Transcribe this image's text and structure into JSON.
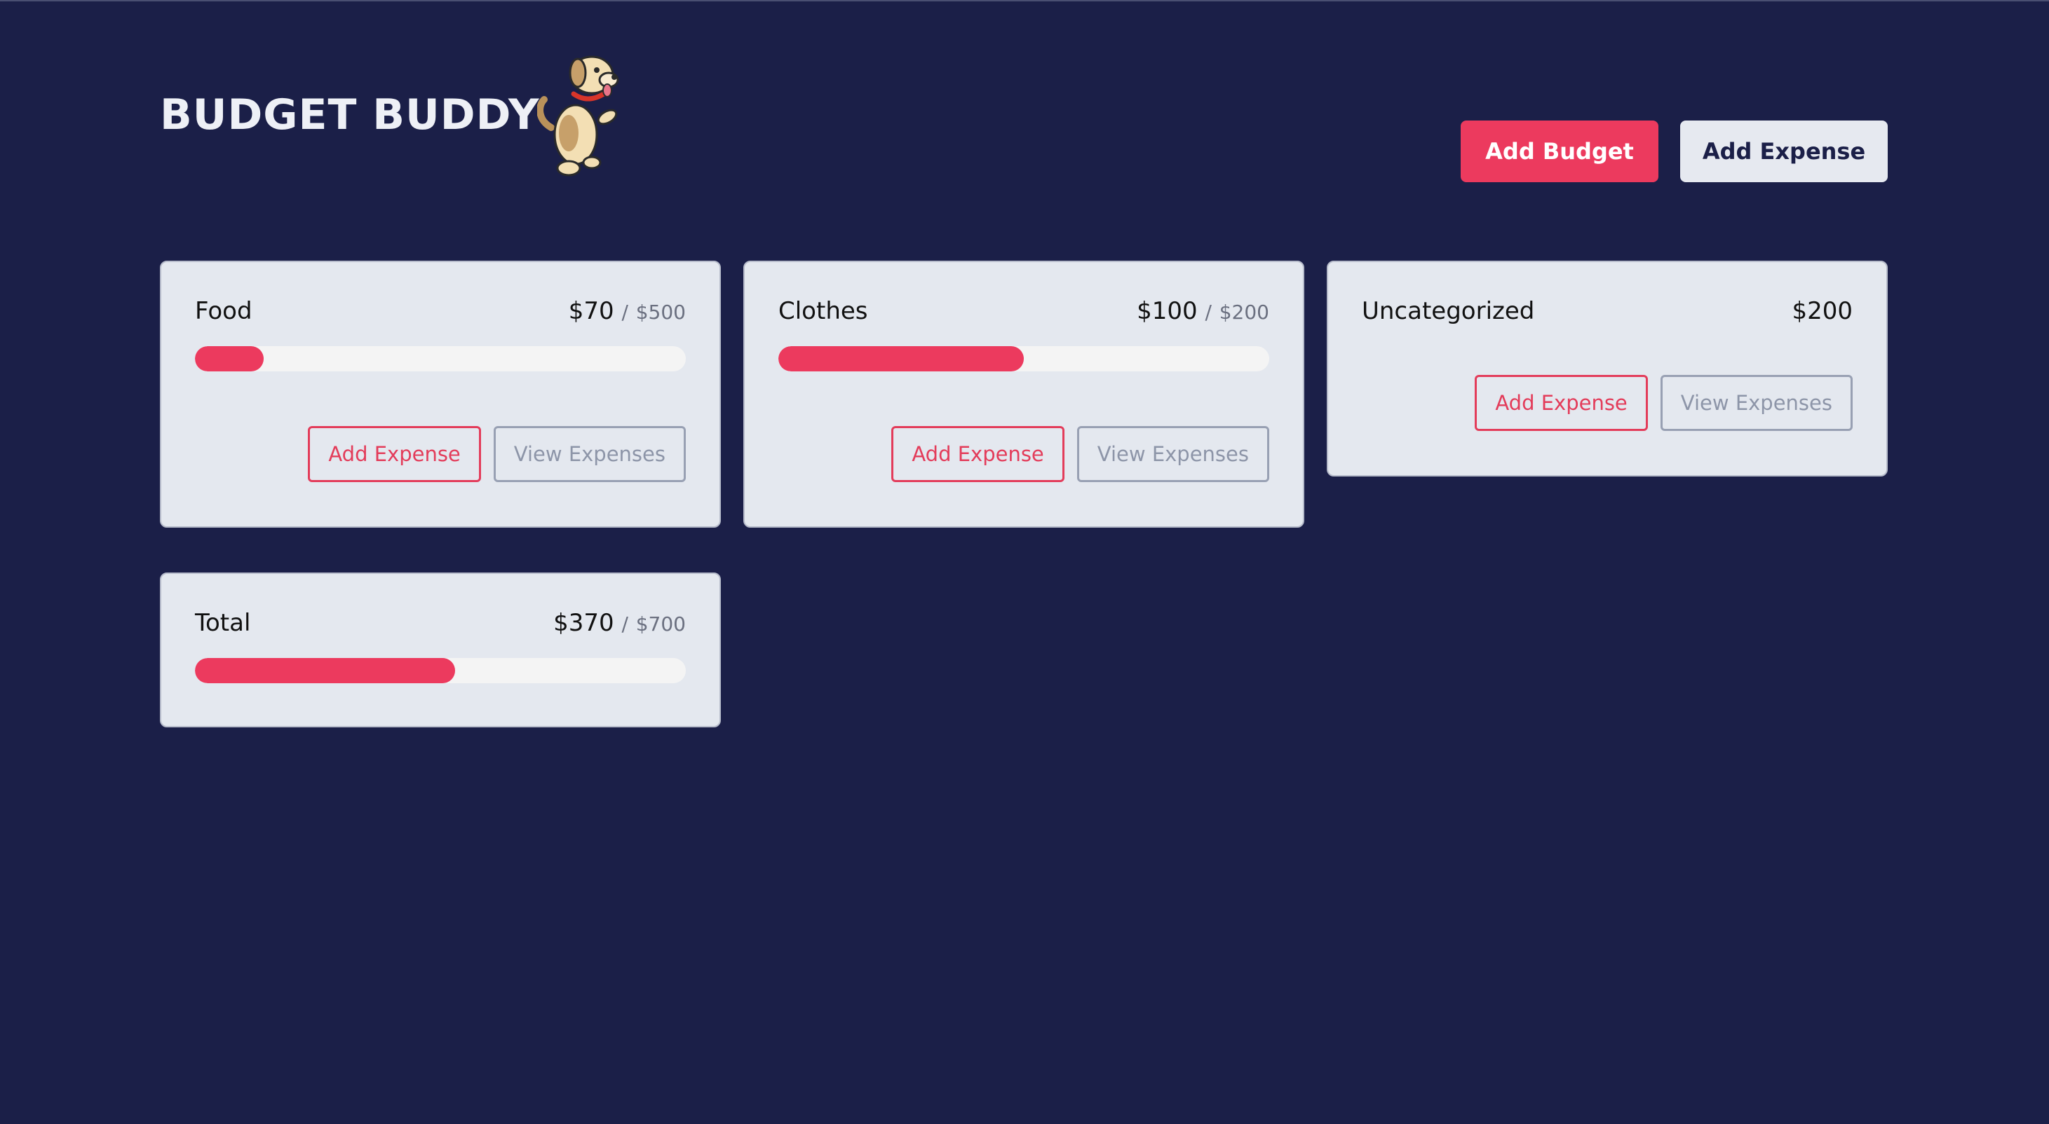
{
  "app": {
    "title": "BUDGET BUDDY"
  },
  "header": {
    "add_budget_label": "Add Budget",
    "add_expense_label": "Add Expense"
  },
  "colors": {
    "background": "#1b1f48",
    "accent": "#ec3a5e",
    "card": "#e4e8ef"
  },
  "budgets": [
    {
      "name": "Food",
      "spent": "$70",
      "separator": "/",
      "max": "$500",
      "progress": 0.14,
      "add_label": "Add Expense",
      "view_label": "View Expenses"
    },
    {
      "name": "Clothes",
      "spent": "$100",
      "separator": "/",
      "max": "$200",
      "progress": 0.5,
      "add_label": "Add Expense",
      "view_label": "View Expenses"
    }
  ],
  "uncategorized": {
    "name": "Uncategorized",
    "spent": "$200",
    "add_label": "Add Expense",
    "view_label": "View Expenses"
  },
  "total": {
    "name": "Total",
    "spent": "$370",
    "separator": "/",
    "max": "$700",
    "progress": 0.53
  }
}
